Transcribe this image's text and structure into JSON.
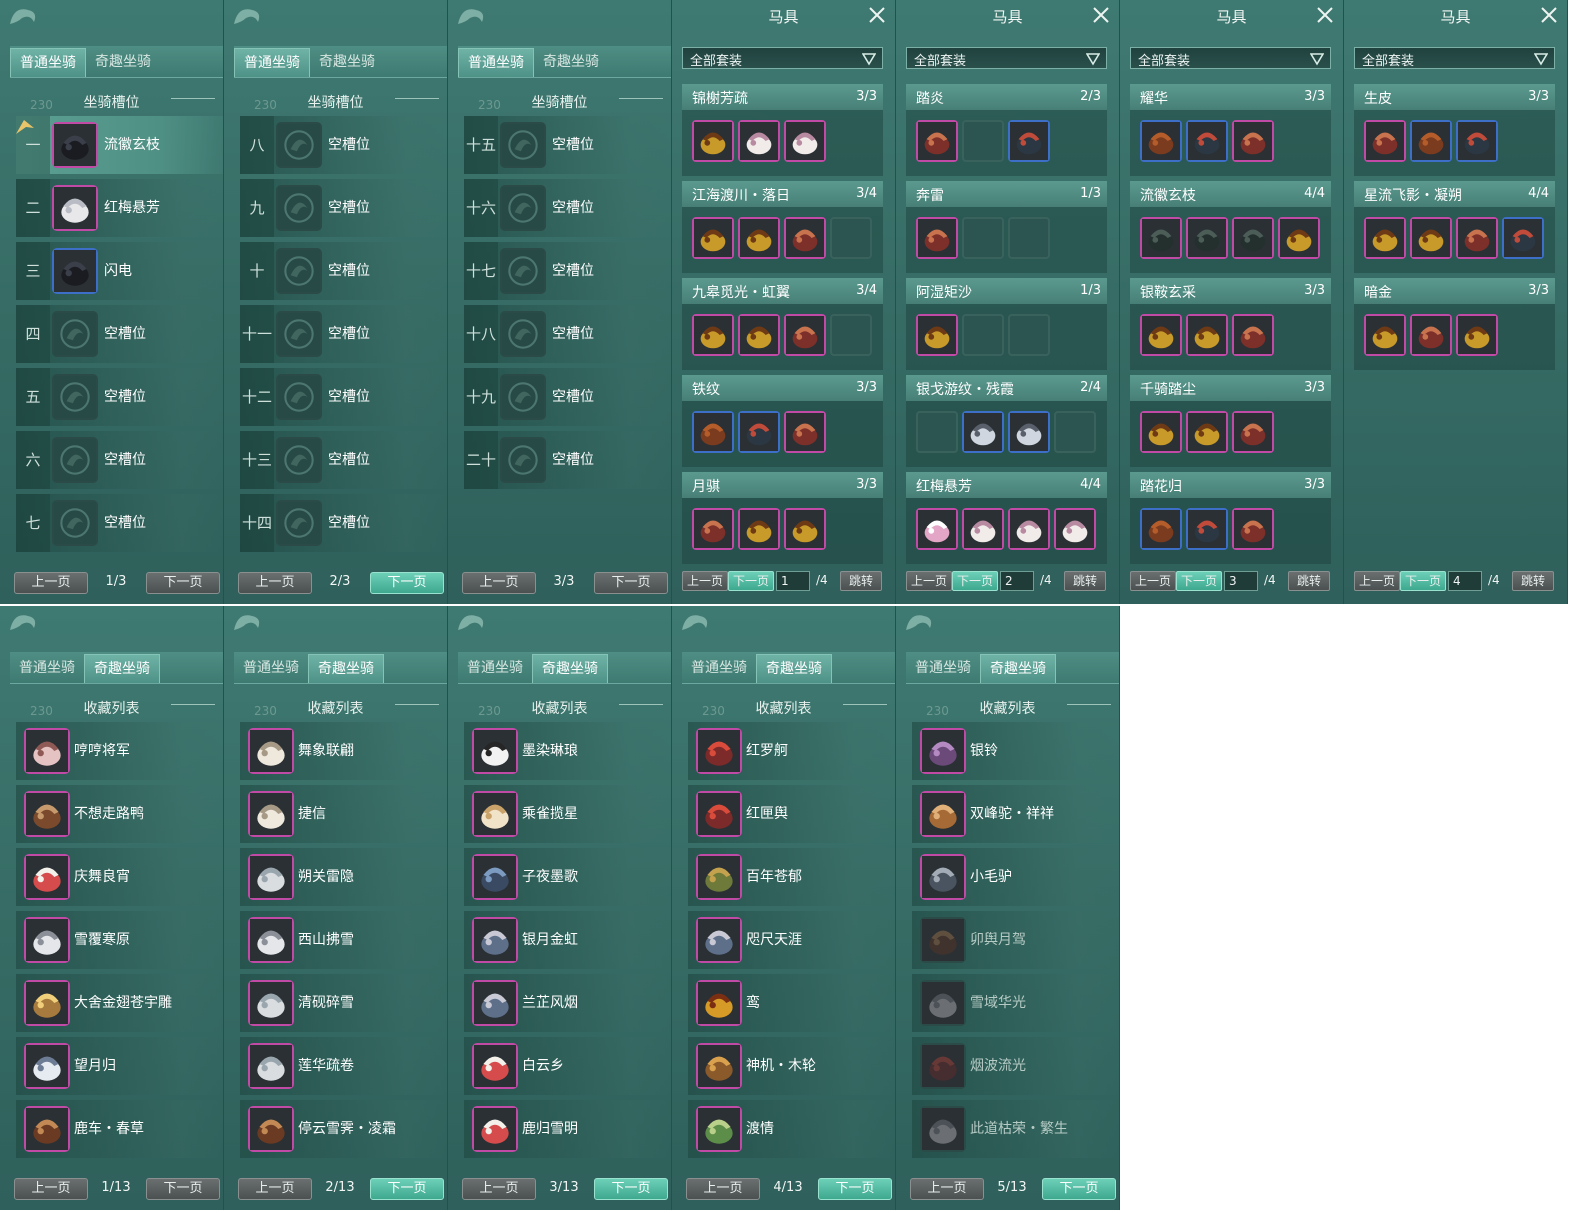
{
  "colors": {
    "panel_bg": "#376d66",
    "tab_active": "#4e9287",
    "page_btn_active": "#3ea88f",
    "quality_purple": "#c04aa5",
    "quality_blue": "#3d6ec8"
  },
  "normal_panels": [
    {
      "tabs": [
        "普通坐骑",
        "奇趣坐骑"
      ],
      "active_tab": 0,
      "section_title": "坐骑槽位",
      "bg_number": "230",
      "rows": [
        {
          "num": "一",
          "name": "流徽玄枝",
          "icon": "black-horse-icon",
          "quality": "purple",
          "selected": true
        },
        {
          "num": "二",
          "name": "红梅悬芳",
          "icon": "white-horse-icon",
          "quality": "purple",
          "selected": false
        },
        {
          "num": "三",
          "name": "闪电",
          "icon": "black-horse-icon",
          "quality": "blue",
          "selected": false
        },
        {
          "num": "四",
          "name": "空槽位",
          "icon": "empty-slot-icon",
          "quality": "none",
          "selected": false
        },
        {
          "num": "五",
          "name": "空槽位",
          "icon": "empty-slot-icon",
          "quality": "none",
          "selected": false
        },
        {
          "num": "六",
          "name": "空槽位",
          "icon": "empty-slot-icon",
          "quality": "none",
          "selected": false
        },
        {
          "num": "七",
          "name": "空槽位",
          "icon": "empty-slot-icon",
          "quality": "none",
          "selected": false
        }
      ],
      "pager": {
        "prev": "上一页",
        "page": "1/3",
        "next": "下一页",
        "next_active": false
      }
    },
    {
      "tabs": [
        "普通坐骑",
        "奇趣坐骑"
      ],
      "active_tab": 0,
      "section_title": "坐骑槽位",
      "bg_number": "230",
      "rows": [
        {
          "num": "八",
          "name": "空槽位",
          "icon": "empty-slot-icon",
          "quality": "none"
        },
        {
          "num": "九",
          "name": "空槽位",
          "icon": "empty-slot-icon",
          "quality": "none"
        },
        {
          "num": "十",
          "name": "空槽位",
          "icon": "empty-slot-icon",
          "quality": "none"
        },
        {
          "num": "十一",
          "name": "空槽位",
          "icon": "empty-slot-icon",
          "quality": "none"
        },
        {
          "num": "十二",
          "name": "空槽位",
          "icon": "empty-slot-icon",
          "quality": "none"
        },
        {
          "num": "十三",
          "name": "空槽位",
          "icon": "empty-slot-icon",
          "quality": "none"
        },
        {
          "num": "十四",
          "name": "空槽位",
          "icon": "empty-slot-icon",
          "quality": "none"
        }
      ],
      "pager": {
        "prev": "上一页",
        "page": "2/3",
        "next": "下一页",
        "next_active": true
      }
    },
    {
      "tabs": [
        "普通坐骑",
        "奇趣坐骑"
      ],
      "active_tab": 0,
      "section_title": "坐骑槽位",
      "bg_number": "230",
      "rows": [
        {
          "num": "十五",
          "name": "空槽位",
          "icon": "empty-slot-icon",
          "quality": "none"
        },
        {
          "num": "十六",
          "name": "空槽位",
          "icon": "empty-slot-icon",
          "quality": "none"
        },
        {
          "num": "十七",
          "name": "空槽位",
          "icon": "empty-slot-icon",
          "quality": "none"
        },
        {
          "num": "十八",
          "name": "空槽位",
          "icon": "empty-slot-icon",
          "quality": "none"
        },
        {
          "num": "十九",
          "name": "空槽位",
          "icon": "empty-slot-icon",
          "quality": "none"
        },
        {
          "num": "二十",
          "name": "空槽位",
          "icon": "empty-slot-icon",
          "quality": "none"
        }
      ],
      "pager": {
        "prev": "上一页",
        "page": "3/3",
        "next": "下一页",
        "next_active": false
      }
    }
  ],
  "saddle_panels": [
    {
      "title": "马具",
      "filter": "全部套装",
      "sets": [
        {
          "name": "锦榭芳疏",
          "count": "3/3",
          "slots": [
            "gold-saddle-icon",
            "white-saddle-icon",
            "white-saddle-icon"
          ]
        },
        {
          "name": "江海渡川・落日",
          "count": "3/4",
          "slots": [
            "gold-saddle-icon",
            "gold-saddle-icon",
            "red-saddle-icon",
            "empty"
          ]
        },
        {
          "name": "九皋觅光・虹翼",
          "count": "3/4",
          "slots": [
            "gold-saddle-icon",
            "gold-saddle-icon",
            "red-saddle-icon",
            "empty"
          ]
        },
        {
          "name": "铁纹",
          "count": "3/3",
          "slots": [
            "brown-saddle-icon",
            "bridle-icon",
            "red-saddle-icon"
          ]
        },
        {
          "name": "月骐",
          "count": "3/3",
          "slots": [
            "red-saddle-icon",
            "gold-saddle-icon",
            "gold-saddle-icon"
          ]
        }
      ],
      "pager": {
        "prev": "上一页",
        "next": "下一页",
        "page_value": "1",
        "total": "/4",
        "jump": "跳转"
      }
    },
    {
      "title": "马具",
      "filter": "全部套装",
      "sets": [
        {
          "name": "踏炎",
          "count": "2/3",
          "slots": [
            "red-saddle-icon",
            "empty",
            "bridle-icon"
          ]
        },
        {
          "name": "奔雷",
          "count": "1/3",
          "slots": [
            "red-saddle-icon",
            "empty",
            "empty"
          ]
        },
        {
          "name": "阿湿矩沙",
          "count": "1/3",
          "slots": [
            "gold-saddle-icon",
            "empty",
            "empty"
          ]
        },
        {
          "name": "银戈游纹・残霞",
          "count": "2/4",
          "slots": [
            "empty",
            "silver-saddle-icon",
            "silver-saddle-icon",
            "empty"
          ]
        },
        {
          "name": "红梅悬芳",
          "count": "4/4",
          "slots": [
            "flower-icon",
            "white-saddle-icon",
            "white-saddle-icon",
            "white-saddle-icon"
          ]
        }
      ],
      "pager": {
        "prev": "上一页",
        "next": "下一页",
        "page_value": "2",
        "total": "/4",
        "jump": "跳转"
      }
    },
    {
      "title": "马具",
      "filter": "全部套装",
      "sets": [
        {
          "name": "耀华",
          "count": "3/3",
          "slots": [
            "brown-saddle-icon",
            "bridle-icon",
            "red-saddle-icon"
          ]
        },
        {
          "name": "流徽玄枝",
          "count": "4/4",
          "slots": [
            "dark-saddle-icon",
            "dark-saddle-icon",
            "dark-saddle-icon",
            "gold-saddle-icon"
          ]
        },
        {
          "name": "银鞍玄采",
          "count": "3/3",
          "slots": [
            "gold-saddle-icon",
            "gold-saddle-icon",
            "red-saddle-icon"
          ]
        },
        {
          "name": "千骑踏尘",
          "count": "3/3",
          "slots": [
            "gold-saddle-icon",
            "gold-saddle-icon",
            "red-saddle-icon"
          ]
        },
        {
          "name": "踏花归",
          "count": "3/3",
          "slots": [
            "brown-saddle-icon",
            "bridle-icon",
            "red-saddle-icon"
          ]
        }
      ],
      "pager": {
        "prev": "上一页",
        "next": "下一页",
        "page_value": "3",
        "total": "/4",
        "jump": "跳转"
      }
    },
    {
      "title": "马具",
      "filter": "全部套装",
      "sets": [
        {
          "name": "生皮",
          "count": "3/3",
          "slots": [
            "red-saddle-icon",
            "brown-saddle-icon",
            "bridle-icon"
          ]
        },
        {
          "name": "星流飞影・凝朔",
          "count": "4/4",
          "slots": [
            "gold-saddle-icon",
            "gold-saddle-icon",
            "red-saddle-icon",
            "bridle-icon"
          ]
        },
        {
          "name": "暗金",
          "count": "3/3",
          "slots": [
            "gold-saddle-icon",
            "red-saddle-icon",
            "gold-saddle-icon"
          ]
        }
      ],
      "pager": {
        "prev": "上一页",
        "next": "下一页",
        "page_value": "4",
        "total": "/4",
        "jump": "跳转"
      }
    }
  ],
  "fun_panels": [
    {
      "tabs": [
        "普通坐骑",
        "奇趣坐骑"
      ],
      "active_tab": 1,
      "section_title": "收藏列表",
      "bg_number": "230",
      "rows": [
        {
          "name": "哼哼将军",
          "icon": "pig-icon",
          "owned": true
        },
        {
          "name": "不想走路鸭",
          "icon": "duck-icon",
          "owned": true
        },
        {
          "name": "庆舞良宵",
          "icon": "lion-dance-icon",
          "owned": true
        },
        {
          "name": "雪覆寒原",
          "icon": "deer-icon",
          "owned": true
        },
        {
          "name": "大舍金翅苍宇雕",
          "icon": "eagle-icon",
          "owned": true
        },
        {
          "name": "望月归",
          "icon": "crane-icon",
          "owned": true
        },
        {
          "name": "鹿车・春草",
          "icon": "cart-icon",
          "owned": true
        }
      ],
      "pager": {
        "prev": "上一页",
        "page": "1/13",
        "next": "下一页",
        "prev_active": false,
        "next_active": false
      }
    },
    {
      "tabs": [
        "普通坐骑",
        "奇趣坐骑"
      ],
      "active_tab": 1,
      "section_title": "收藏列表",
      "bg_number": "230",
      "rows": [
        {
          "name": "舞象联翩",
          "icon": "elephant-icon",
          "owned": true
        },
        {
          "name": "捷信",
          "icon": "elephant-icon",
          "owned": true
        },
        {
          "name": "朔关雷隐",
          "icon": "horse-icon",
          "owned": true
        },
        {
          "name": "西山拂雪",
          "icon": "deer-icon",
          "owned": true
        },
        {
          "name": "清砚碎雪",
          "icon": "horse-icon",
          "owned": true
        },
        {
          "name": "莲华疏卷",
          "icon": "horse-icon",
          "owned": true
        },
        {
          "name": "停云雪霁・凌霜",
          "icon": "cart-icon",
          "owned": true
        }
      ],
      "pager": {
        "prev": "上一页",
        "page": "2/13",
        "next": "下一页",
        "next_active": true
      }
    },
    {
      "tabs": [
        "普通坐骑",
        "奇趣坐骑"
      ],
      "active_tab": 1,
      "section_title": "收藏列表",
      "bg_number": "230",
      "rows": [
        {
          "name": "墨染琳琅",
          "icon": "panda-icon",
          "owned": true
        },
        {
          "name": "乘雀揽星",
          "icon": "bird-icon",
          "owned": true
        },
        {
          "name": "子夜墨歌",
          "icon": "dragon-icon",
          "owned": true
        },
        {
          "name": "银月金虹",
          "icon": "vehicle-icon",
          "owned": true
        },
        {
          "name": "兰芷风烟",
          "icon": "vehicle-icon",
          "owned": true
        },
        {
          "name": "白云乡",
          "icon": "lion-dance-icon",
          "owned": true
        },
        {
          "name": "鹿归雪明",
          "icon": "lion-dance-icon",
          "owned": true
        }
      ],
      "pager": {
        "prev": "上一页",
        "page": "3/13",
        "next": "下一页",
        "next_active": true
      }
    },
    {
      "tabs": [
        "普通坐骑",
        "奇趣坐骑"
      ],
      "active_tab": 1,
      "section_title": "收藏列表",
      "bg_number": "230",
      "rows": [
        {
          "name": "红罗舸",
          "icon": "boat-icon",
          "owned": true
        },
        {
          "name": "红匣舆",
          "icon": "boat-icon",
          "owned": true
        },
        {
          "name": "百年苍郁",
          "icon": "turtle-icon",
          "owned": true
        },
        {
          "name": "咫尺天涯",
          "icon": "vehicle-icon",
          "owned": true
        },
        {
          "name": "鸾",
          "icon": "lantern-icon",
          "owned": true
        },
        {
          "name": "神机・木轮",
          "icon": "wheel-icon",
          "owned": true
        },
        {
          "name": "渡情",
          "icon": "carpet-icon",
          "owned": true
        }
      ],
      "pager": {
        "prev": "上一页",
        "page": "4/13",
        "next": "下一页",
        "next_active": true
      }
    },
    {
      "tabs": [
        "普通坐骑",
        "奇趣坐骑"
      ],
      "active_tab": 1,
      "section_title": "收藏列表",
      "bg_number": "230",
      "rows": [
        {
          "name": "银铃",
          "icon": "beast-icon",
          "owned": true
        },
        {
          "name": "双峰驼・祥祥",
          "icon": "camel-icon",
          "owned": true
        },
        {
          "name": "小毛驴",
          "icon": "donkey-icon",
          "owned": true
        },
        {
          "name": "卯舆月驾",
          "icon": "cart-icon",
          "owned": false
        },
        {
          "name": "雪域华光",
          "icon": "deer-icon",
          "owned": false
        },
        {
          "name": "烟波流光",
          "icon": "boat-icon",
          "owned": false
        },
        {
          "name": "此道枯荣・繁生",
          "icon": "deer-icon",
          "owned": false
        }
      ],
      "pager": {
        "prev": "上一页",
        "page": "5/13",
        "next": "下一页",
        "next_active": true
      }
    }
  ]
}
